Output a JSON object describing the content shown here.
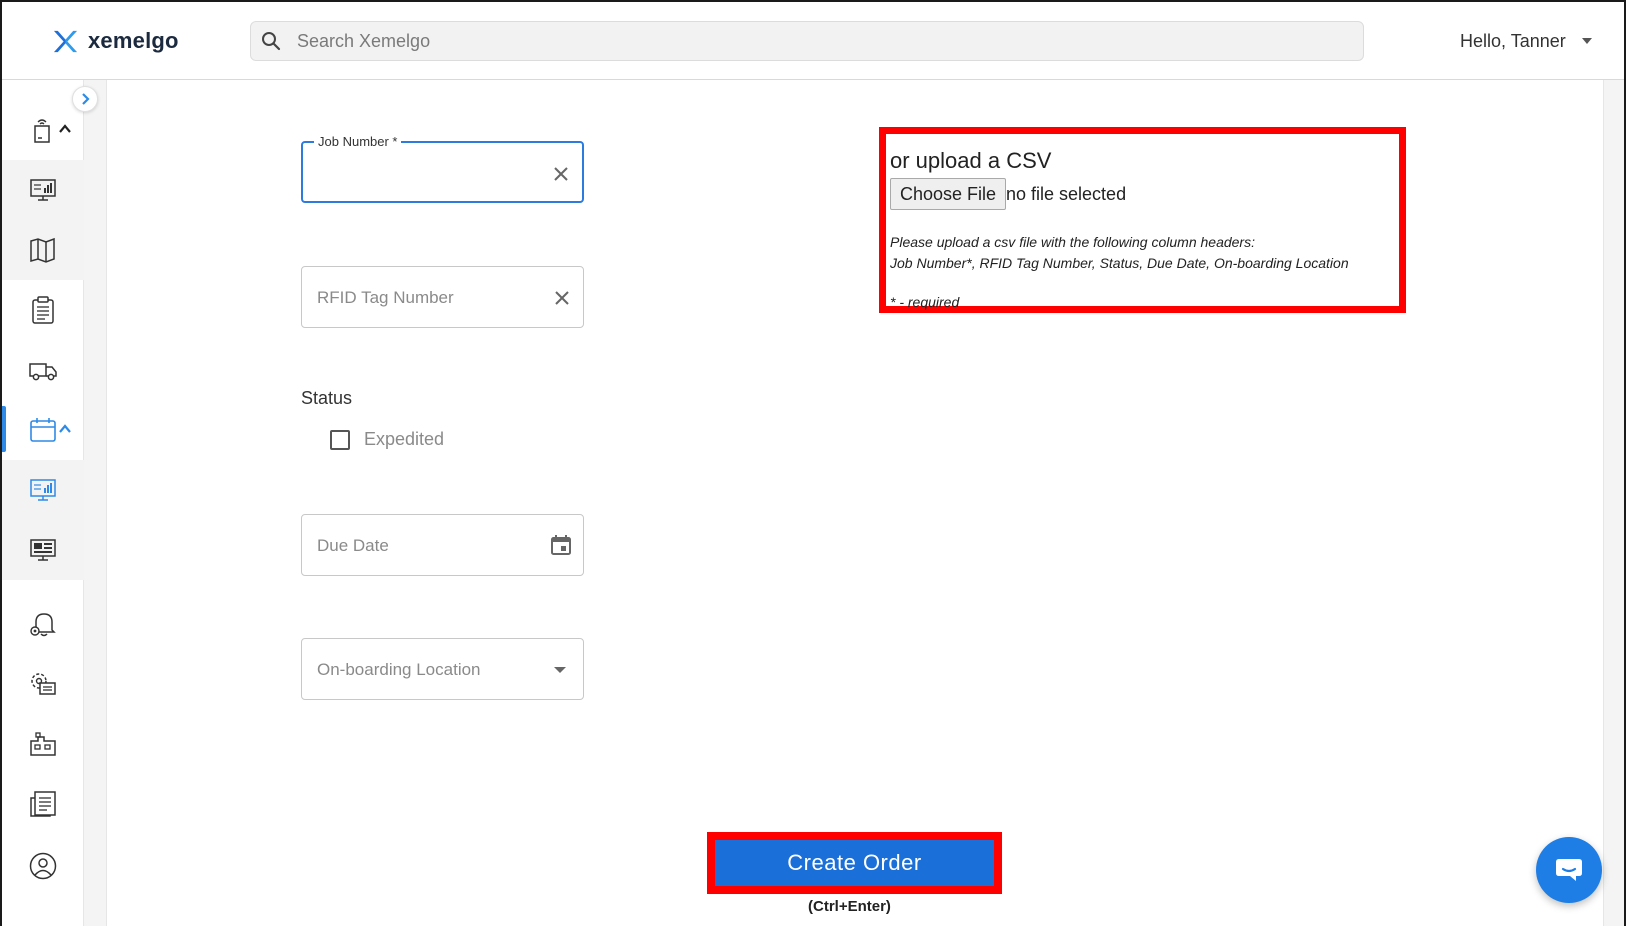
{
  "header": {
    "brand": "xemelgo",
    "search_placeholder": "Search Xemelgo",
    "greeting": "Hello, Tanner"
  },
  "sidebar": {
    "items": [
      {
        "icon": "rfid-device-icon",
        "has_chevron": true
      },
      {
        "icon": "dashboard-monitor-icon"
      },
      {
        "icon": "map-icon"
      },
      {
        "icon": "clipboard-list-icon"
      },
      {
        "icon": "delivery-truck-icon"
      },
      {
        "icon": "calendar-icon",
        "has_chevron": true,
        "active": true
      },
      {
        "icon": "dashboard-monitor-icon"
      },
      {
        "icon": "monitor-widgets-icon"
      },
      {
        "icon": "alert-bell-gear-icon"
      },
      {
        "icon": "settings-card-icon"
      },
      {
        "icon": "factory-icon"
      },
      {
        "icon": "report-list-icon"
      },
      {
        "icon": "user-profile-icon"
      }
    ]
  },
  "form": {
    "job_number_label": "Job Number *",
    "rfid_placeholder": "RFID Tag Number",
    "status_label": "Status",
    "expedited_label": "Expedited",
    "due_date_placeholder": "Due Date",
    "onboarding_placeholder": "On-boarding Location"
  },
  "csv": {
    "title": "or upload a CSV",
    "choose_file": "Choose File",
    "file_status": "no file selected",
    "help_line1": "Please upload a csv file with the following column headers:",
    "help_line2": "Job Number*, RFID Tag Number, Status, Due Date, On-boarding Location",
    "required_note": "* - required"
  },
  "actions": {
    "create_label": "Create Order",
    "shortcut": "(Ctrl+Enter)"
  },
  "colors": {
    "accent": "#1b6fd8",
    "highlight": "#ff0000",
    "active_indicator": "#2e8ae6"
  }
}
